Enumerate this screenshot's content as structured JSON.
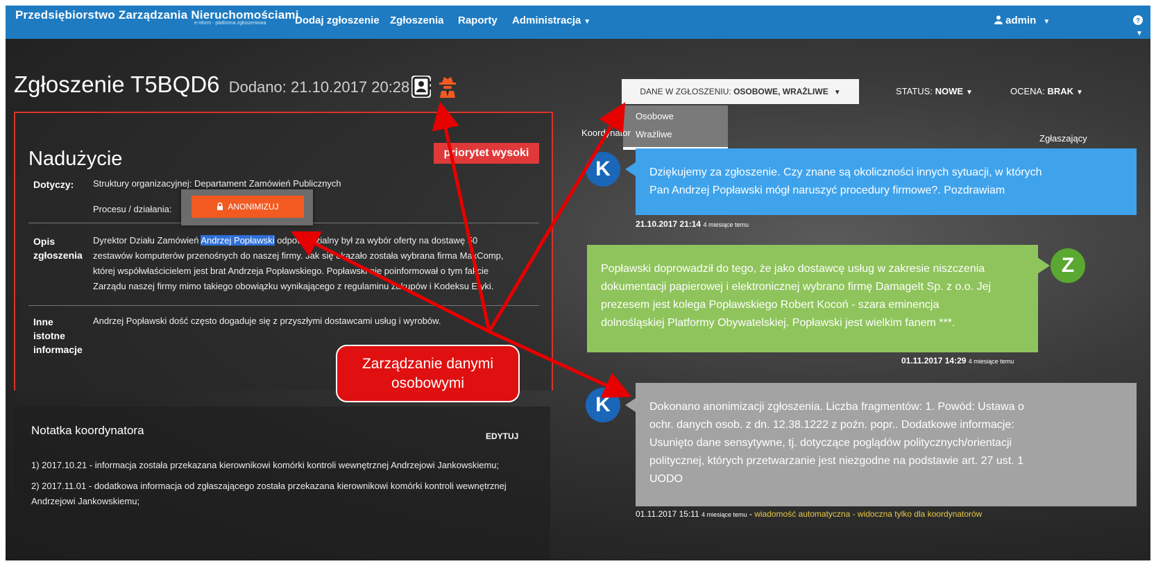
{
  "navbar": {
    "brand": "Przedsiębiorstwo Zarządzania Nieruchomościami",
    "brand_sub": "e-nform - platforma zgłoszeniowa",
    "links": [
      "Dodaj zgłoszenie",
      "Zgłoszenia",
      "Raporty",
      "Administracja"
    ],
    "user": "admin",
    "help_icon": "question-circle-icon"
  },
  "header": {
    "title": "Zgłoszenie T5BQD6",
    "added": "Dodano: 21.10.2017 20:28",
    "icons": [
      "personal-data-icon",
      "sensitive-spy-icon"
    ]
  },
  "report": {
    "category": "Nadużycie",
    "priority": "priorytet wysoki",
    "dotyczy_label": "Dotyczy:",
    "dotyczy_value": "Struktury organizacyjnej: Departament Zamówień Publicznych",
    "proces_label": "Procesu / działania:",
    "opis_label_1": "Opis",
    "opis_label_2": "zgłoszenia",
    "opis_prefix": "Dyrektor Działu Zamówień",
    "opis_highlight": "Andrzej Popławski",
    "opis_line1_rest": "odpowiedzialny był za wybór oferty na dostawę 50",
    "opis_line2": "zestawów komputerów przenośnych do naszej firmy. Jak się okazało została wybrana firma MaxComp,",
    "opis_line3": "której współwłaścicielem jest brat Andrzeja Popławskiego. Popławski nie poinformował o tym fakcie",
    "opis_line4": "Zarządu naszej firmy mimo takiego obowiązku wynikającego z regulaminu zakupów i Kodeksu Etyki.",
    "inne_label_1": "Inne",
    "inne_label_2": "istotne",
    "inne_label_3": "informacje",
    "inne_value": "Andrzej Popławski dość często dogaduje się z przyszłymi dostawcami usług i wyrobów.",
    "anonymize_button": "ANONIMIZUJ"
  },
  "notes": {
    "title": "Notatka koordynatora",
    "edit_label": "EDYTUJ",
    "note1": "1) 2017.10.21 - informacja została przekazana kierownikowi komórki kontroli wewnętrznej Andrzejowi Jankowskiemu;",
    "note2_line1": "2) 2017.11.01 - dodatkowa informacja od zgłaszającego została przekazana kierownikowi komórki kontroli wewnętrznej",
    "note2_line2": "Andrzejowi Jankowskiemu;"
  },
  "data_dropdown": {
    "label": "DANE W ZGŁOSZENIU:",
    "value": "OSOBOWE, WRAŻLIWE",
    "options": [
      "Osobowe",
      "Wrażliwe"
    ]
  },
  "status": {
    "label": "STATUS:",
    "value": "NOWE"
  },
  "rating": {
    "label": "OCENA:",
    "value": "BRAK"
  },
  "chat": {
    "left_header": "Koordynator",
    "right_header": "Zgłaszający",
    "messages": [
      {
        "avatar": "K",
        "lines": [
          "Dziękujemy za zgłoszenie. Czy znane są okoliczności innych sytuacji, w których",
          "Pan Andrzej Popławski mógł naruszyć procedury firmowe?. Pozdrawiam"
        ],
        "date": "21.10.2017 21:14",
        "ago": "4 miesiące temu",
        "color": "#3fa3ec"
      },
      {
        "avatar": "Z",
        "lines": [
          "Popławski doprowadził do tego, że jako dostawcę usług w zakresie niszczenia",
          "dokumentacji papierowej i elektronicznej wybrano firmę DamageIt Sp. z o.o. Jej",
          "prezesem jest kolega Popławskiego Robert Kocoń - szara eminencja",
          "dolnośląskiej Platformy Obywatelskiej. Popławski jest wielkim fanem ***."
        ],
        "date": "01.11.2017 14:29",
        "ago": "4 miesiące temu",
        "color": "#8fc45c"
      },
      {
        "avatar": "K",
        "lines": [
          "Dokonano anonimizacji zgłoszenia. Liczba fragmentów: 1. Powód: Ustawa o",
          "ochr. danych osob. z dn. 12.38.1222 z poźn. popr.. Dodatkowe informacje:",
          "Usunięto dane sensytywne, tj. dotyczące poglądów politycznych/orientacji",
          "politycznej, których przetwarzanie jest niezgodne na podstawie art. 27 ust. 1",
          "UODO"
        ],
        "date": "01.11.2017 15:11",
        "ago": "4 miesiące temu",
        "auto_note": "wiadomość automatyczna - widoczna tylko dla koordynatorów",
        "color": "#a3a3a3"
      }
    ]
  },
  "annotation": {
    "callout_line1": "Zarządzanie danymi",
    "callout_line2": "osobowymi"
  },
  "colors": {
    "navbar": "#1e7bc2",
    "accent_red": "#e0393a",
    "anonymize": "#f25a22",
    "avatar_k": "#1a66b8",
    "avatar_z": "#5aa832"
  }
}
